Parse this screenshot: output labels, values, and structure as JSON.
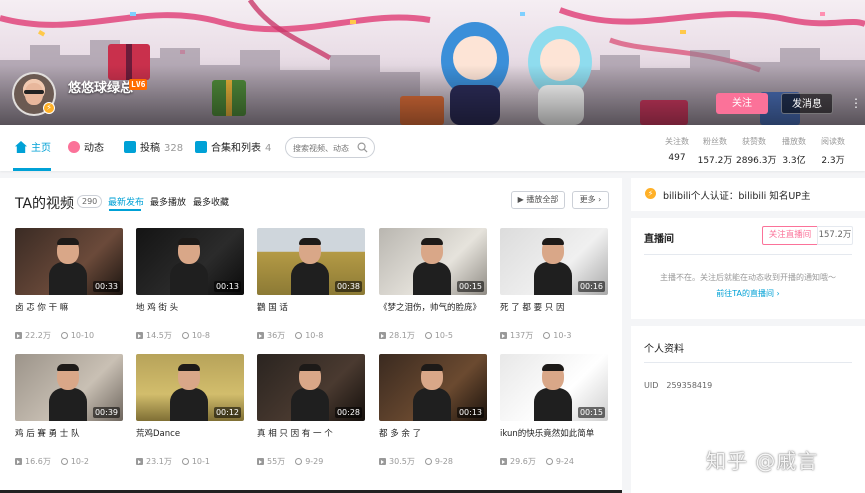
{
  "profile": {
    "username": "悠悠球绿总",
    "level": "LV6",
    "follow_label": "关注",
    "message_label": "发消息",
    "more_label": "⋮"
  },
  "nav": {
    "home": "主页",
    "dynamic": "动态",
    "posts": "投稿",
    "posts_count": "328",
    "collections": "合集和列表",
    "collections_count": "4",
    "search_placeholder": "搜索视频、动态"
  },
  "stats": [
    {
      "label": "关注数",
      "value": "497"
    },
    {
      "label": "粉丝数",
      "value": "157.2万"
    },
    {
      "label": "获赞数",
      "value": "2896.3万"
    },
    {
      "label": "播放数",
      "value": "3.3亿"
    },
    {
      "label": "阅读数",
      "value": "2.3万"
    }
  ],
  "videos_section": {
    "title": "TA的视频",
    "count": "290",
    "sort_latest": "最新发布",
    "sort_most_played": "最多播放",
    "sort_most_fav": "最多收藏",
    "play_all": "播放全部",
    "more": "更多"
  },
  "videos": [
    {
      "title": "卤 忑 你 干 嘛",
      "duration": "00:33",
      "views": "22.2万",
      "date": "10-10"
    },
    {
      "title": "地 鸡 街 头",
      "duration": "00:13",
      "views": "14.5万",
      "date": "10-8"
    },
    {
      "title": "鸛 国 话",
      "duration": "00:38",
      "views": "36万",
      "date": "10-8"
    },
    {
      "title": "《梦之泪伤，帅气的脸庞》",
      "duration": "00:15",
      "views": "28.1万",
      "date": "10-5"
    },
    {
      "title": "死 了 都 要 只 因",
      "duration": "00:16",
      "views": "137万",
      "date": "10-3"
    },
    {
      "title": "鸡 后 賽 勇 士 队",
      "duration": "00:39",
      "views": "16.6万",
      "date": "10-2"
    },
    {
      "title": "荒鸡Dance",
      "duration": "00:12",
      "views": "23.1万",
      "date": "10-1"
    },
    {
      "title": "真 相 只 因 有 一 个",
      "duration": "00:28",
      "views": "55万",
      "date": "9-29"
    },
    {
      "title": "都 多 余 了",
      "duration": "00:13",
      "views": "30.5万",
      "date": "9-28"
    },
    {
      "title": "ikun的快乐竟然如此简单",
      "duration": "00:15",
      "views": "29.6万",
      "date": "9-24"
    }
  ],
  "sidebar": {
    "verify_text": "bilibili个人认证：bilibili 知名UP主",
    "live_title": "直播间",
    "live_follow": "关注直播间",
    "live_count": "157.2万",
    "live_message": "主播不在。关注后就能在动态收到开播的通知哦～",
    "live_link": "前往TA的直播间 ›",
    "info_title": "个人资料",
    "uid_label": "UID",
    "uid_value": "259358419"
  },
  "watermark": "知乎 @戚言",
  "colors": {
    "accent_blue": "#00a1d6",
    "pink": "#fb7299",
    "gold": "#ffb027"
  }
}
